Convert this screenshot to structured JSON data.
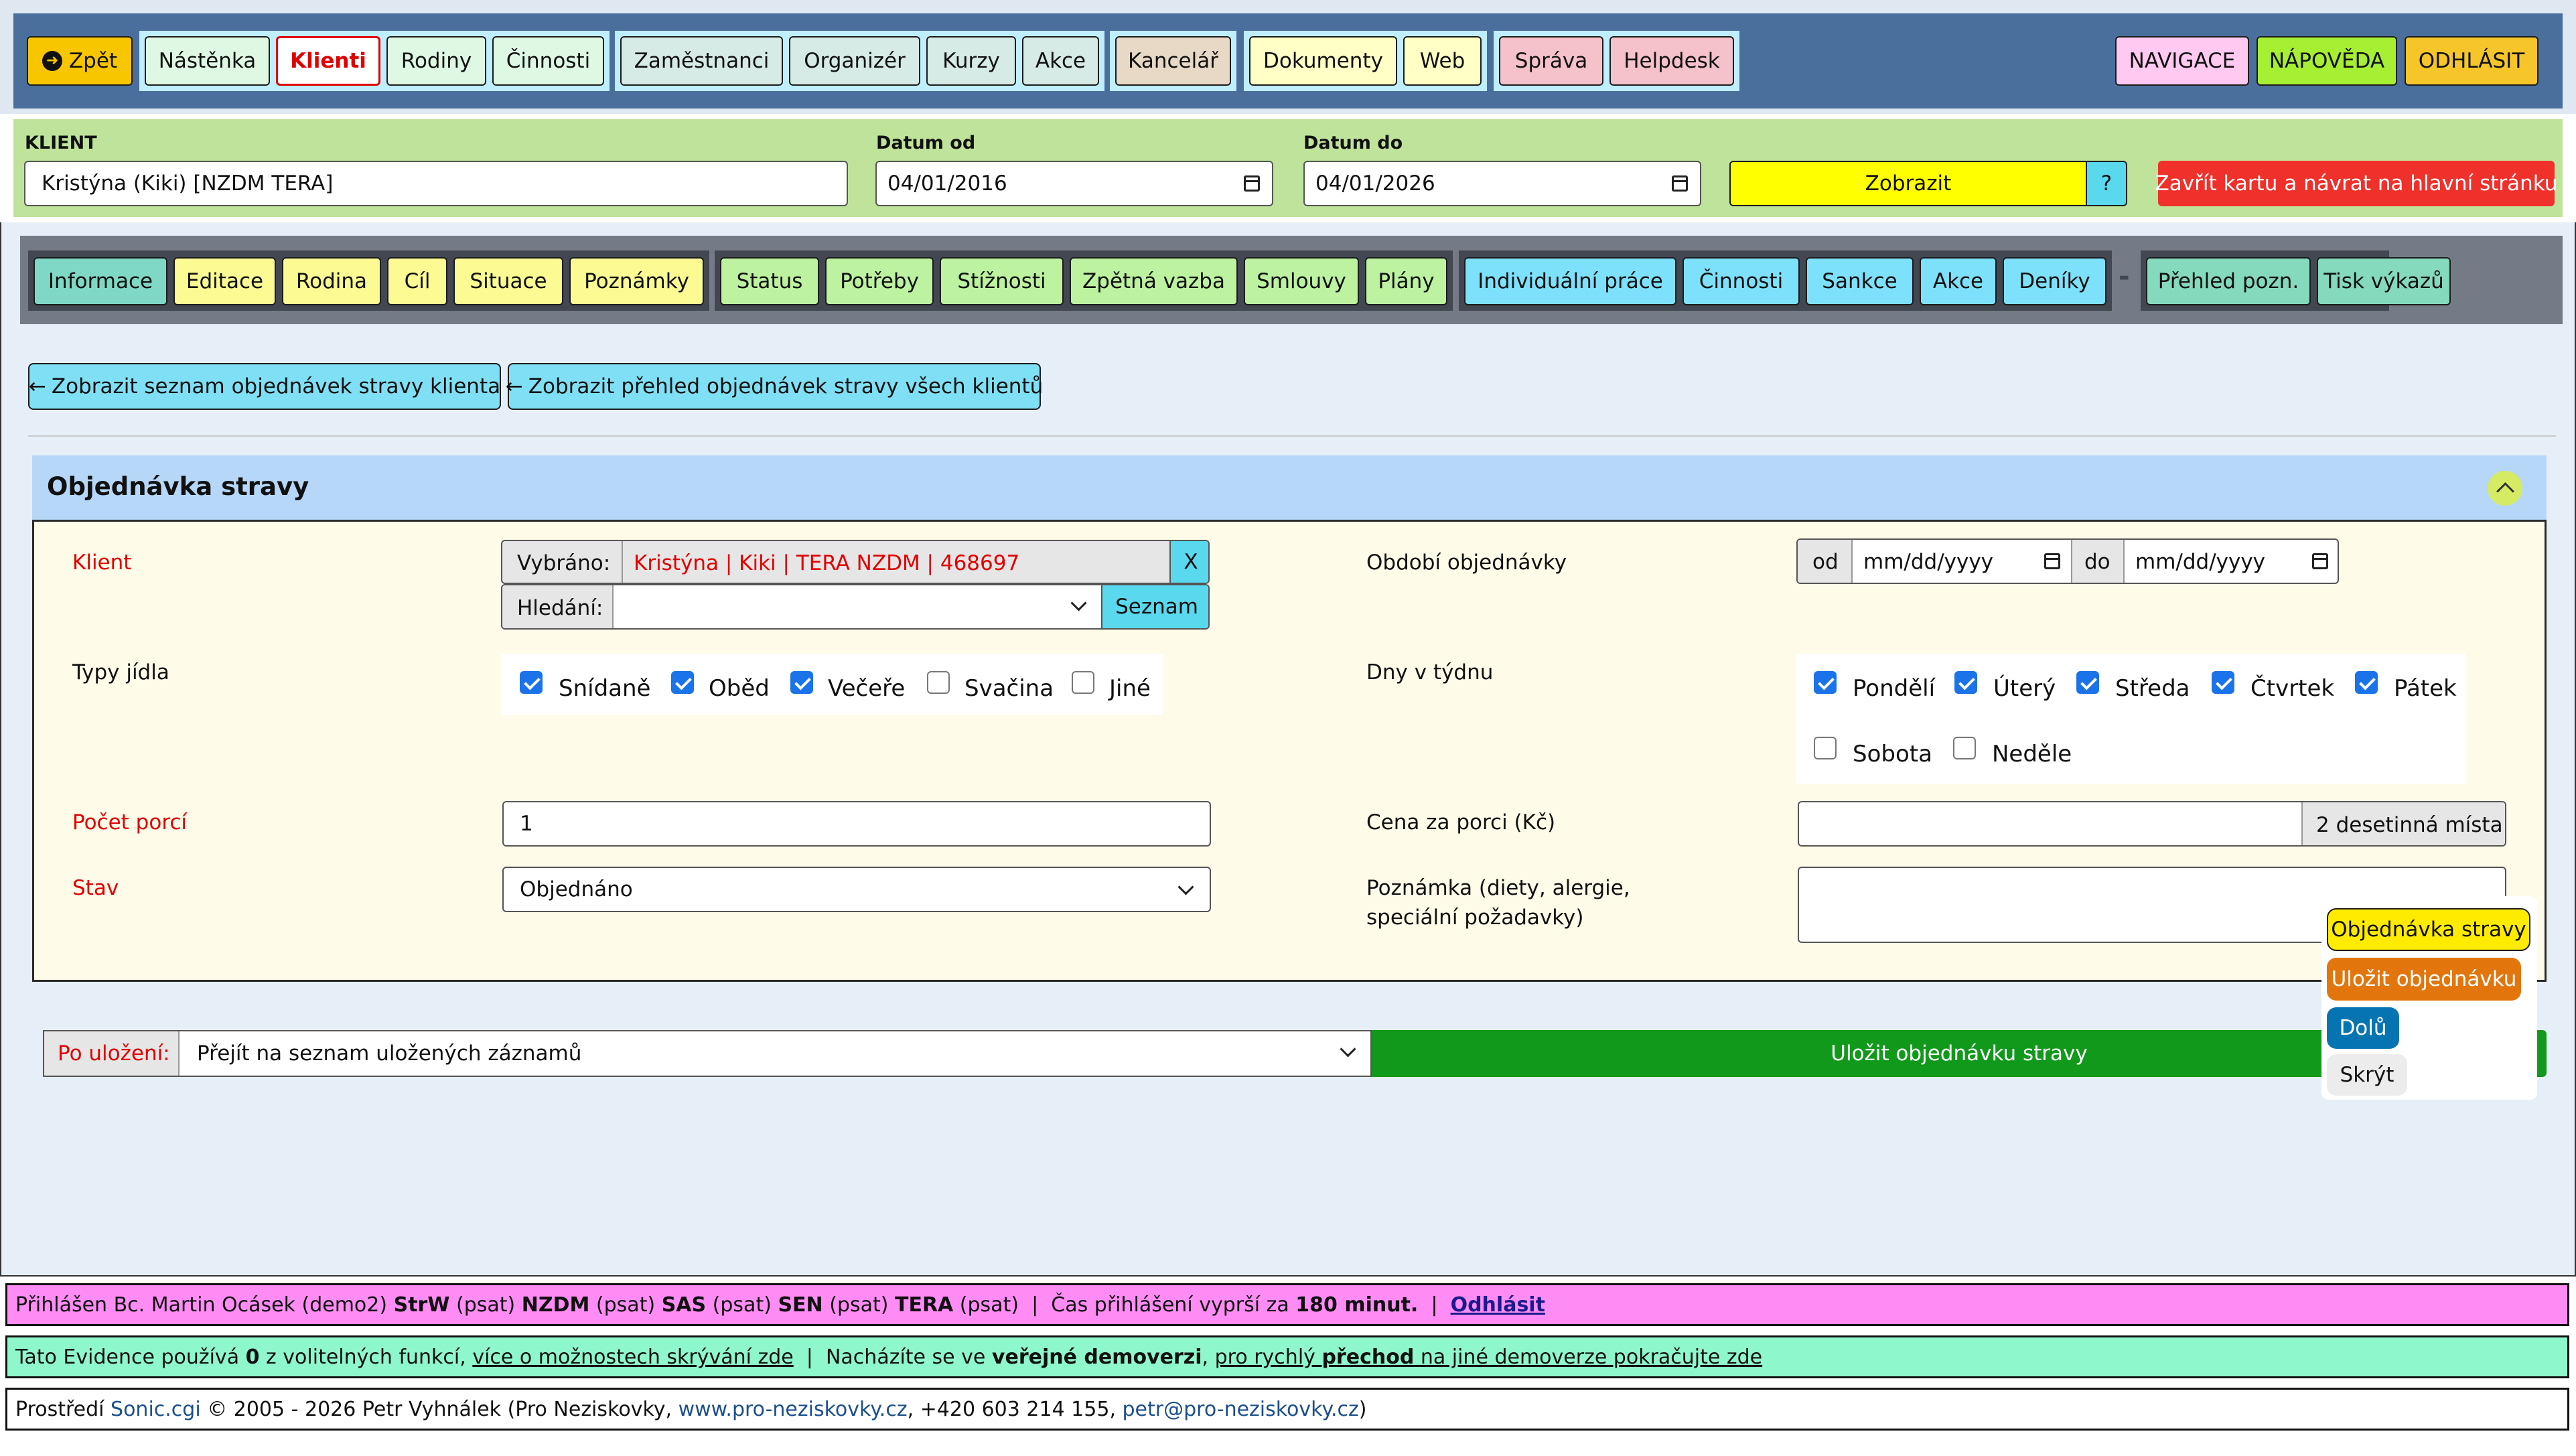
{
  "topnav": {
    "back": "Zpět",
    "group1": [
      "Nástěnka",
      "Klienti",
      "Rodiny",
      "Činnosti"
    ],
    "group2": [
      "Zaměstnanci",
      "Organizér",
      "Kurzy",
      "Akce"
    ],
    "group3": [
      "Kancelář"
    ],
    "group4": [
      "Dokumenty",
      "Web"
    ],
    "group5": [
      "Správa",
      "Helpdesk"
    ],
    "right": [
      "NAVIGACE",
      "NÁPOVĚDA",
      "ODHLÁSIT"
    ]
  },
  "filter": {
    "client_label": "KLIENT",
    "client_value": "Kristýna (Kiki) [NZDM TERA]",
    "date_from_label": "Datum od",
    "date_from_value": "04/01/2016",
    "date_to_label": "Datum do",
    "date_to_value": "04/01/2026",
    "show": "Zobrazit",
    "help": "?",
    "close": "Zavřít kartu a návrat na hlavní stránku"
  },
  "subnav": {
    "group1": [
      "Informace",
      "Editace",
      "Rodina",
      "Cíl",
      "Situace",
      "Poznámky"
    ],
    "group2": [
      "Status",
      "Potřeby",
      "Stížnosti",
      "Zpětná vazba",
      "Smlouvy",
      "Plány"
    ],
    "group3": [
      "Individuální práce",
      "Činnosti",
      "Sankce",
      "Akce",
      "Deníky"
    ],
    "separator": "-",
    "group4": [
      "Přehled pozn.",
      "Tisk výkazů"
    ]
  },
  "links": {
    "client_orders": "Zobrazit seznam objednávek stravy klienta",
    "all_orders": "Zobrazit přehled objednávek stravy všech klientů"
  },
  "form": {
    "title": "Objednávka stravy",
    "client_label": "Klient",
    "selected_prefix": "Vybráno:",
    "selected_value": "Kristýna | Kiki | TERA NZDM | 468697",
    "clear": "X",
    "search_prefix": "Hledání:",
    "search_value": "",
    "list_button": "Seznam",
    "period_label": "Období objednávky",
    "period_from": "od",
    "period_to": "do",
    "date_placeholder": "mm/dd/yyyy",
    "meal_types_label": "Typy jídla",
    "meal_types": [
      {
        "label": "Snídaně",
        "checked": true
      },
      {
        "label": "Oběd",
        "checked": true
      },
      {
        "label": "Večeře",
        "checked": true
      },
      {
        "label": "Svačina",
        "checked": false
      },
      {
        "label": "Jiné",
        "checked": false
      }
    ],
    "days_label": "Dny v týdnu",
    "days": [
      {
        "label": "Pondělí",
        "checked": true
      },
      {
        "label": "Úterý",
        "checked": true
      },
      {
        "label": "Středa",
        "checked": true
      },
      {
        "label": "Čtvrtek",
        "checked": true
      },
      {
        "label": "Pátek",
        "checked": true
      },
      {
        "label": "Sobota",
        "checked": false
      },
      {
        "label": "Neděle",
        "checked": false
      }
    ],
    "portions_label": "Počet porcí",
    "portions_value": "1",
    "price_label": "Cena za porci (Kč)",
    "price_value": "",
    "price_hint": "2 desetinná místa",
    "status_label": "Stav",
    "status_value": "Objednáno",
    "note_label_1": "Poznámka (diety, alergie,",
    "note_label_2": "speciální požadavky)",
    "note_value": ""
  },
  "save": {
    "after_label": "Po uložení:",
    "after_value": "Přejít na seznam uložených záznamů",
    "submit": "Uložit objednávku stravy"
  },
  "floating": {
    "title": "Objednávka stravy",
    "save": "Uložit objednávku",
    "down": "Dolů",
    "hide": "Skrýt"
  },
  "footer": {
    "line1": {
      "prefix": "Přihlášen Bc. Martin Ocásek (demo2) ",
      "r1": "StrW",
      "p1": " (psat) ",
      "r2": "NZDM",
      "p2": " (psat) ",
      "r3": "SAS",
      "p3": " (psat) ",
      "r4": "SEN",
      "p4": " (psat) ",
      "r5": "TERA",
      "p5": " (psat)  |  Čas přihlášení vyprší za ",
      "minutes": "180 minut.",
      "sep": "  |  ",
      "logout": "Odhlásit"
    },
    "line2": {
      "a": "Tato Evidence používá ",
      "count": "0",
      "b": " z volitelných funkcí, ",
      "link1": "více o možnostech skrývání zde",
      "c": "  |  Nacházíte se ve ",
      "public": "veřejné demoverzi",
      "d": ", ",
      "link2a": "pro rychlý ",
      "link2b": "přechod",
      "link2c": " na jiné demoverze pokračujte zde"
    },
    "line3": {
      "a": "Prostředí ",
      "sonic": "Sonic.cgi",
      "b": " © 2005 - 2026 Petr Vyhnálek (Pro Neziskovky, ",
      "web": "www.pro-neziskovky.cz",
      "c": ", +420 603 214 155, ",
      "mail": "petr@pro-neziskovky.cz",
      "d": ")"
    }
  },
  "colors": {
    "topbar": "#4a6f9c",
    "filterbar": "#bfe39b",
    "subnav": "#757b86",
    "page": "#e6eff7",
    "section_header": "#b6d7f8",
    "form_bg": "#fefbe9",
    "save_green": "#11991b",
    "footer_pink": "#ff8cf5",
    "footer_green": "#8ff7cc"
  }
}
